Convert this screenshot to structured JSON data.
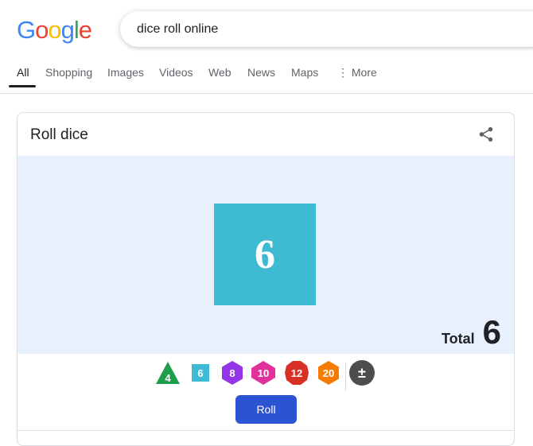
{
  "logo": {
    "letters": [
      "G",
      "o",
      "o",
      "g",
      "l",
      "e"
    ],
    "colors": [
      "#4285f4",
      "#ea4335",
      "#fbbc05",
      "#4285f4",
      "#34a853",
      "#ea4335"
    ]
  },
  "search": {
    "query": "dice roll online"
  },
  "tabs": [
    {
      "label": "All",
      "active": true
    },
    {
      "label": "Shopping"
    },
    {
      "label": "Images"
    },
    {
      "label": "Videos"
    },
    {
      "label": "Web"
    },
    {
      "label": "News"
    },
    {
      "label": "Maps"
    },
    {
      "label": "More",
      "icon": "more-vert-icon"
    }
  ],
  "card": {
    "title": "Roll dice",
    "share_icon": "share-icon",
    "result_die": {
      "sides": 6,
      "value": "6",
      "color": "#3ebbd2"
    },
    "total_label": "Total",
    "total_value": "6",
    "dice": [
      {
        "label": "4",
        "shape": "triangle",
        "color": "#1e9e4a"
      },
      {
        "label": "6",
        "shape": "square",
        "color": "#3ebbd2"
      },
      {
        "label": "8",
        "shape": "hexagon",
        "color": "#9334e6"
      },
      {
        "label": "10",
        "shape": "diamond-hex",
        "color": "#e0329a"
      },
      {
        "label": "12",
        "shape": "decagon",
        "color": "#d93025"
      },
      {
        "label": "20",
        "shape": "hexagon",
        "color": "#f57c00"
      },
      {
        "label": "±",
        "shape": "circle",
        "color": "#4d4d4d"
      }
    ],
    "roll_label": "Roll",
    "roll_color": "#2b53d2"
  }
}
